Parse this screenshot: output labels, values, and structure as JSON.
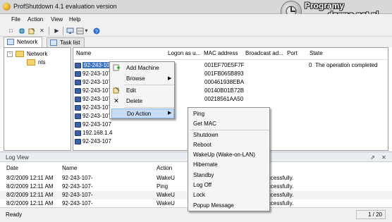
{
  "window": {
    "title": "ProfShutdown 4.1 evaluation version",
    "brand_line1": "Programy",
    "brand_za": "za",
    "brand_line2": "darmo.net.pl"
  },
  "menu": [
    "File",
    "Action",
    "View",
    "Help"
  ],
  "tabs": [
    {
      "label": "Network",
      "active": true
    },
    {
      "label": "Task list",
      "active": false
    }
  ],
  "tree": {
    "root": "Network",
    "child": "nts"
  },
  "grid": {
    "columns": [
      "Name",
      "Logon as u...",
      "MAC address",
      "Broadcast ad...",
      "Port",
      "State"
    ],
    "rows": [
      {
        "name": "92-243-107",
        "mac": "001EF70E5F7F",
        "port": "0",
        "state": "The operation completed"
      },
      {
        "name": "92-243-107",
        "mac": "001FB065B893",
        "port": "",
        "state": ""
      },
      {
        "name": "92-243-107",
        "mac": "000461938EBA",
        "port": "",
        "state": ""
      },
      {
        "name": "92-243-107",
        "mac": "00140B01B72B",
        "port": "",
        "state": ""
      },
      {
        "name": "92-243-107",
        "mac": "00218561AA50",
        "port": "",
        "state": ""
      },
      {
        "name": "92-243-107",
        "mac": "",
        "port": "",
        "state": ""
      },
      {
        "name": "92-243-107",
        "mac": "",
        "port": "",
        "state": ""
      },
      {
        "name": "92-243-107",
        "mac": "",
        "port": "",
        "state": ""
      },
      {
        "name": "192.168.1.4",
        "mac": "",
        "port": "",
        "state": ""
      },
      {
        "name": "92-243-107",
        "mac": "",
        "port": "",
        "state": ""
      }
    ]
  },
  "context_menu": {
    "items": [
      "Add Machine",
      "Browse",
      "Edit",
      "Delete",
      "Do Action"
    ],
    "highlighted": "Do Action"
  },
  "submenu": {
    "items": [
      "Ping",
      "Get MAC",
      "Shutdown",
      "Reboot",
      "WakeUp (Wake-on-LAN)",
      "Hibernate",
      "Standby",
      "Log Off",
      "Lock",
      "Popup Message"
    ]
  },
  "log": {
    "title": "Log View",
    "columns": [
      "Date",
      "Name",
      "Action"
    ],
    "rows": [
      {
        "date": "8/2/2009 12:11 AM",
        "name": "92-243-107-",
        "action": "WakeU",
        "result": "ccessfully."
      },
      {
        "date": "8/2/2009 12:11 AM",
        "name": "92-243-107-",
        "action": "Ping",
        "result": "ccessfully."
      },
      {
        "date": "8/2/2009 12:11 AM",
        "name": "92-243-107-",
        "action": "WakeU",
        "result": "ccessfully."
      },
      {
        "date": "8/2/2009 12:11 AM",
        "name": "92-243-107-",
        "action": "WakeU",
        "result": "ccessfully."
      }
    ]
  },
  "status": {
    "text": "Ready",
    "page": "1 / 20"
  }
}
